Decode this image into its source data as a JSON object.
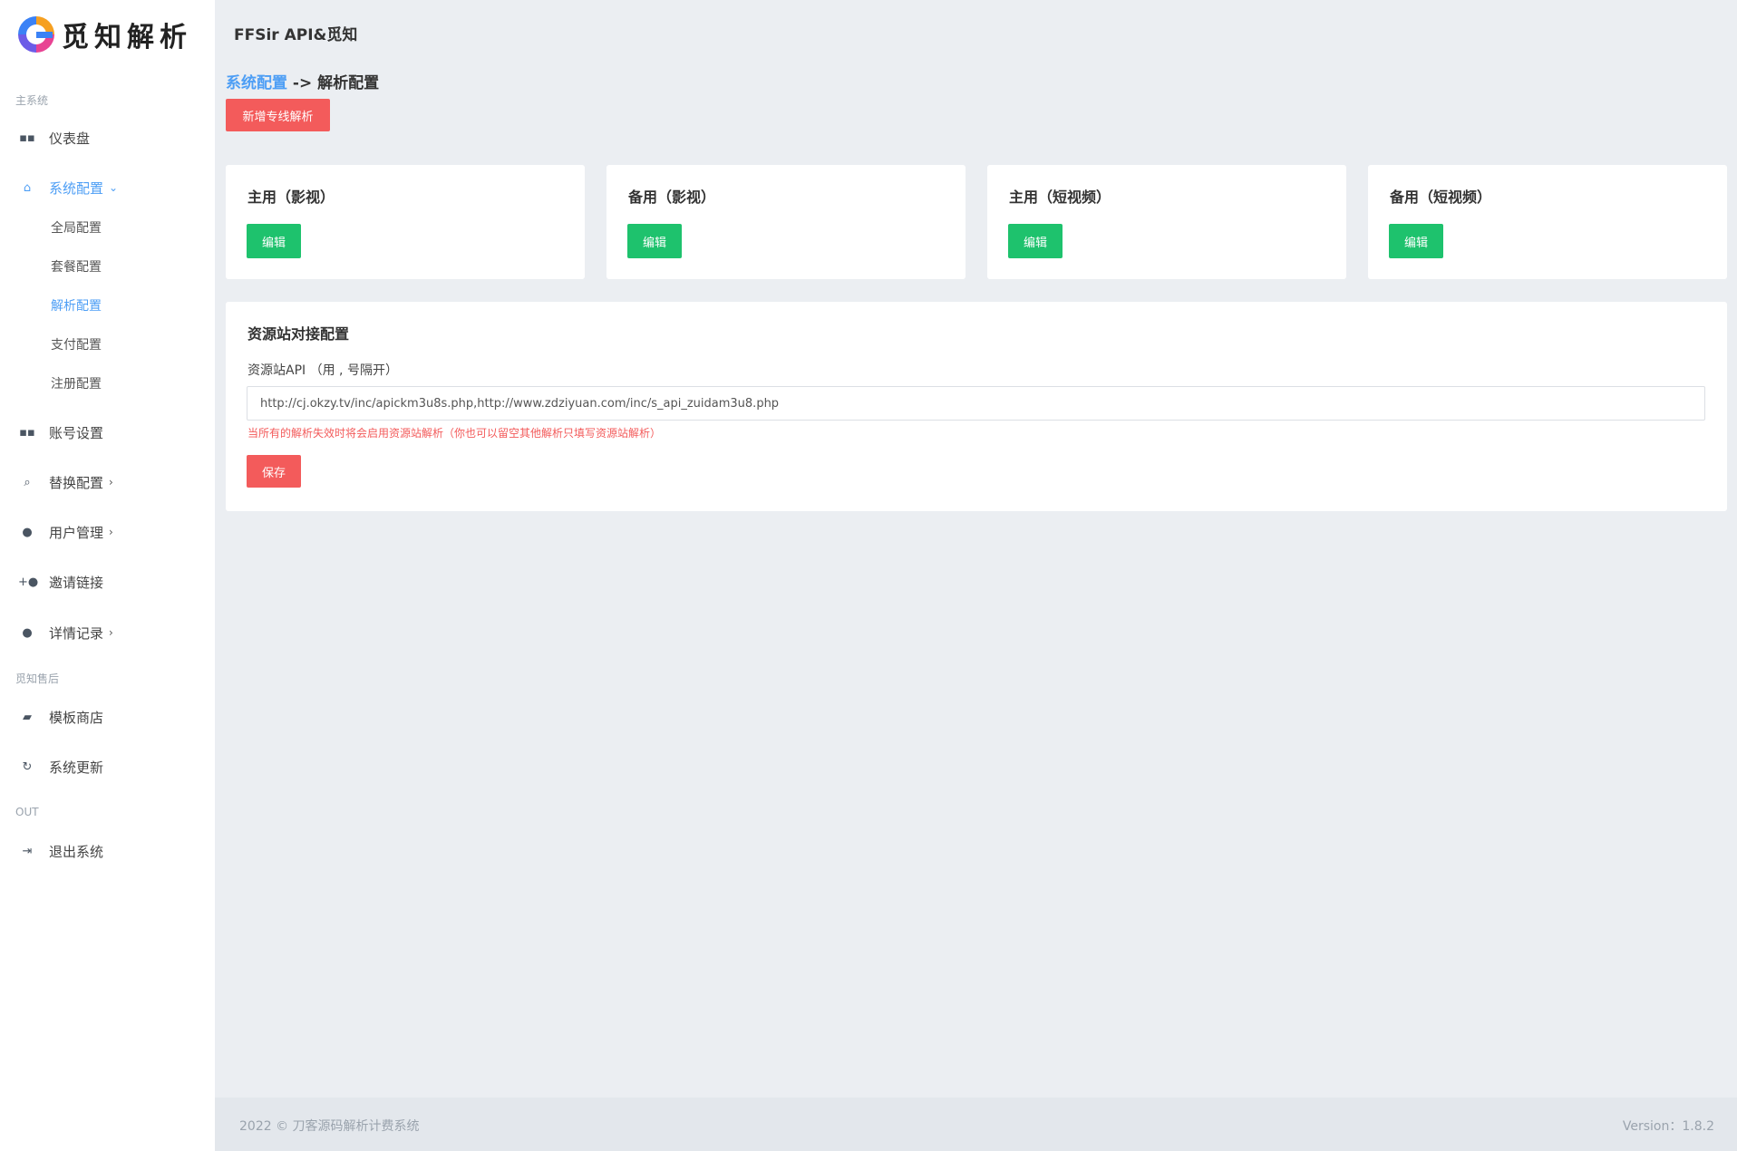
{
  "logo": {
    "text": "觅知解析"
  },
  "sidebar": {
    "sections": [
      {
        "label": "主系统"
      },
      {
        "label": "觅知售后"
      },
      {
        "label": "OUT"
      }
    ],
    "items": [
      {
        "label": "仪表盘",
        "icon": "dashboard-icon"
      },
      {
        "label": "系统配置",
        "icon": "home-icon",
        "chevron": "⌄"
      },
      {
        "label": "账号设置",
        "icon": "dashboard-icon"
      },
      {
        "label": "替换配置",
        "icon": "search-icon",
        "chevron": "›"
      },
      {
        "label": "用户管理",
        "icon": "user-icon",
        "chevron": "›"
      },
      {
        "label": "邀请链接",
        "icon": "user-plus-icon"
      },
      {
        "label": "详情记录",
        "icon": "dot-icon",
        "chevron": "›"
      },
      {
        "label": "模板商店",
        "icon": "bag-icon"
      },
      {
        "label": "系统更新",
        "icon": "refresh-icon"
      },
      {
        "label": "退出系统",
        "icon": "logout-icon"
      }
    ],
    "sub_items": [
      {
        "label": "全局配置"
      },
      {
        "label": "套餐配置"
      },
      {
        "label": "解析配置"
      },
      {
        "label": "支付配置"
      },
      {
        "label": "注册配置"
      }
    ]
  },
  "topbar": {
    "title": "FFSir API&觅知"
  },
  "breadcrumb": {
    "link": "系统配置",
    "separator": " -> ",
    "current": "解析配置"
  },
  "add_button": {
    "label": "新增专线解析"
  },
  "cards": [
    {
      "title": "主用（影视）",
      "button": "编辑"
    },
    {
      "title": "备用（影视）",
      "button": "编辑"
    },
    {
      "title": "主用（短视频）",
      "button": "编辑"
    },
    {
      "title": "备用（短视频）",
      "button": "编辑"
    }
  ],
  "resource_panel": {
    "title": "资源站对接配置",
    "field_label": "资源站API （用 , 号隔开）",
    "field_value": "http://cj.okzy.tv/inc/apickm3u8s.php,http://www.zdziyuan.com/inc/s_api_zuidam3u8.php",
    "hint": "当所有的解析失效时将会启用资源站解析（你也可以留空其他解析只填写资源站解析）",
    "save_label": "保存"
  },
  "footer": {
    "copyright": "2022 © 刀客源码解析计费系统",
    "version": "Version：1.8.2"
  },
  "colors": {
    "accent": "#4d9ef5",
    "danger": "#f35b5b",
    "success": "#1ec26d",
    "background": "#ebeef2"
  }
}
